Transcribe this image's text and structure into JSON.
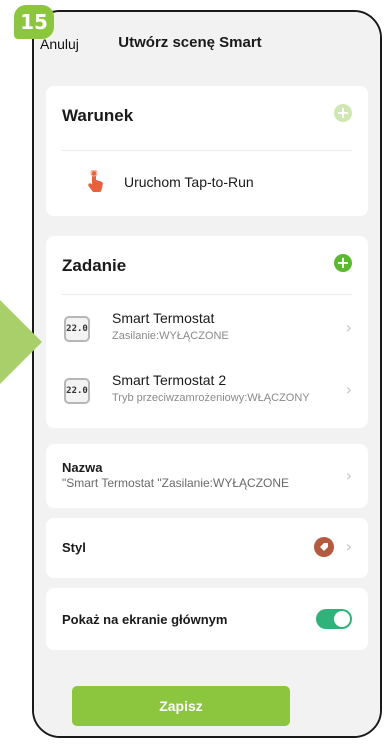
{
  "step_badge": "15",
  "header": {
    "cancel_label": "Anuluj",
    "title": "Utwórz scenę Smart"
  },
  "condition": {
    "title": "Warunek",
    "add_icon": "plus-icon",
    "item_label": "Uruchom Tap-to-Run",
    "item_icon": "tap-hand-icon"
  },
  "task": {
    "title": "Zadanie",
    "add_icon": "plus-icon",
    "items": [
      {
        "name": "Smart Termostat",
        "detail": "Zasilanie:WYŁĄCZONE",
        "icon_text": "22.0"
      },
      {
        "name": "Smart Termostat 2",
        "detail": "Tryb przeciwzamrożeniowy:WŁĄCZONY",
        "icon_text": "22.0"
      }
    ]
  },
  "name_row": {
    "label": "Nazwa",
    "value": "\"Smart Termostat \"Zasilanie:WYŁĄCZONE"
  },
  "style_row": {
    "label": "Styl",
    "icon": "style-tag-icon"
  },
  "home_row": {
    "label": "Pokaż na ekranie głównym",
    "enabled": true
  },
  "save_label": "Zapisz",
  "colors": {
    "accent_green": "#8cc63f",
    "plus_light": "#cfe8b3",
    "plus_dark": "#5cb82e",
    "toggle_on": "#2fb37a",
    "tap_icon": "#e8603c",
    "style_icon": "#b35a3f"
  }
}
